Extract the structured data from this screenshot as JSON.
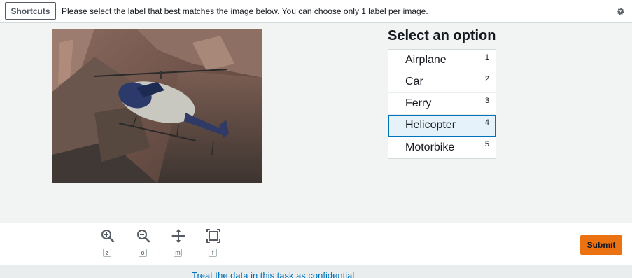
{
  "header": {
    "shortcuts_label": "Shortcuts",
    "instructions": "Please select the label that best matches the image below. You can choose only 1 label per image.",
    "settings_icon": "gear-icon"
  },
  "image": {
    "subject": "helicopter"
  },
  "options_panel": {
    "title": "Select an option",
    "options": [
      {
        "label": "Airplane",
        "key": "1",
        "selected": false
      },
      {
        "label": "Car",
        "key": "2",
        "selected": false
      },
      {
        "label": "Ferry",
        "key": "3",
        "selected": false
      },
      {
        "label": "Helicopter",
        "key": "4",
        "selected": true
      },
      {
        "label": "Motorbike",
        "key": "5",
        "selected": false
      }
    ]
  },
  "toolbar": {
    "tools": [
      {
        "icon": "zoom-in-icon",
        "key": "z"
      },
      {
        "icon": "zoom-out-icon",
        "key": "o"
      },
      {
        "icon": "move-icon",
        "key": "m"
      },
      {
        "icon": "fit-screen-icon",
        "key": "f"
      }
    ],
    "submit_label": "Submit"
  },
  "footer": {
    "confidential_text": "Treat the data in this task as confidential"
  },
  "colors": {
    "accent": "#0073bb",
    "submit": "#ec7211",
    "selected_bg": "#e6f2fa"
  }
}
